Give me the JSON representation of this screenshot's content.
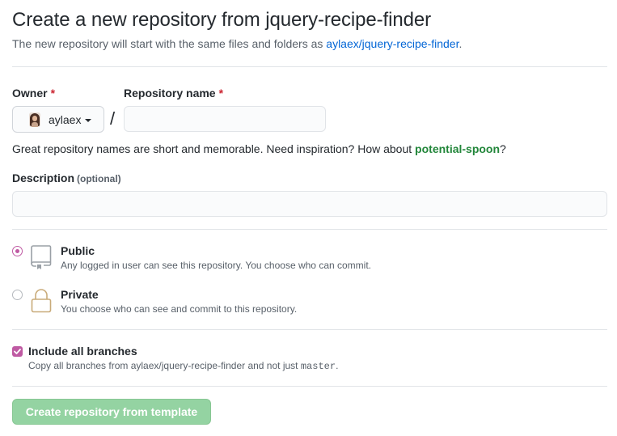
{
  "header": {
    "title": "Create a new repository from jquery-recipe-finder",
    "subtitle_prefix": "The new repository will start with the same files and folders as ",
    "template_link": "aylaex/jquery-recipe-finder",
    "subtitle_suffix": "."
  },
  "owner": {
    "label": "Owner",
    "required_mark": "*",
    "value": "aylaex",
    "icon": "user-avatar"
  },
  "repo_name": {
    "label": "Repository name",
    "required_mark": "*",
    "separator": "/",
    "value": "",
    "placeholder": ""
  },
  "hint": {
    "prefix": "Great repository names are short and memorable. Need inspiration? How about ",
    "suggestion": "potential-spoon",
    "suffix": "?"
  },
  "description": {
    "label": "Description",
    "optional": "(optional)",
    "value": "",
    "placeholder": ""
  },
  "visibility": {
    "selected": "public",
    "options": [
      {
        "id": "public",
        "title": "Public",
        "desc": "Any logged in user can see this repository. You choose who can commit.",
        "icon": "repo-icon"
      },
      {
        "id": "private",
        "title": "Private",
        "desc": "You choose who can see and commit to this repository.",
        "icon": "lock-icon"
      }
    ]
  },
  "branches": {
    "checked": true,
    "label": "Include all branches",
    "desc_prefix": "Copy all branches from aylaex/jquery-recipe-finder and not just ",
    "desc_code": "master",
    "desc_suffix": "."
  },
  "submit": {
    "label": "Create repository from template",
    "disabled": true
  },
  "colors": {
    "accent": "#bf5aa3",
    "link": "#0366d6",
    "suggestion": "#22863a",
    "required": "#cb2431",
    "button_disabled": "#94d3a2",
    "lock_icon": "#c9ab7a",
    "repo_icon": "#9aa0a6"
  }
}
